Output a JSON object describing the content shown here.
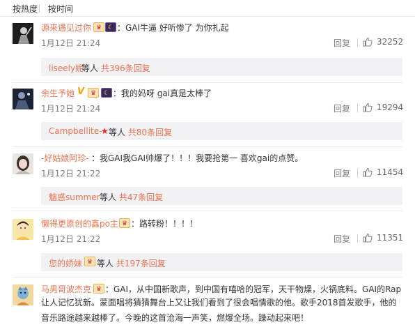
{
  "sort_tabs": [
    "按热度",
    "按时间"
  ],
  "comments": [
    {
      "user": "源来遇见过你",
      "badges": [
        "vip-icon",
        "night-icon"
      ],
      "text": "：GAI牛逼  好听惨了 为你扎起",
      "time": "1月12日 21:24",
      "reply_label": "回复",
      "likes": "32252",
      "sub_user": "liseely妮",
      "sub_middle": " 等人 ",
      "sub_count": "共396条回复"
    },
    {
      "user": "余生予她",
      "badges": [
        "verified-v-icon",
        "vip-icon",
        "night-icon"
      ],
      "text": "：我的妈呀 gai真是太棒了",
      "time": "1月12日 21:24",
      "reply_label": "回复",
      "likes": "19294",
      "sub_user": "Campbellite-",
      "sub_middle": " 等人 ",
      "sub_count": "共80条回复"
    },
    {
      "user": "-好姑娘阿珍-",
      "badges": [],
      "text": "：我GAI我GAI帅爆了！！！我要抢第一 喜欢gai的点赞。",
      "time": "1月12日 21:22",
      "reply_label": "回复",
      "likes": "11454",
      "sub_user": "魑惑summer",
      "sub_middle": " 等人 ",
      "sub_count": "共47条回复"
    },
    {
      "user": "懒得更原创的鑫po主",
      "badges": [
        "vip-icon"
      ],
      "text": "：路转粉！！！！",
      "time": "1月12日 21:22",
      "reply_label": "回复",
      "likes": "11351",
      "sub_user": "您的娇妹",
      "sub_middle": " 等人 ",
      "sub_count": "共197条回复"
    },
    {
      "user": "马男哥波杰克",
      "badges": [
        "vip-icon"
      ],
      "text_lines": [
        "：GAI，从中国新歌声，到中国有嘻哈的冠军，天干物燥，火锅底料。GAI的Rap",
        "让人记忆犹新。蒙面唱将猜猜舞台上又让我们看到了很会唱情歌的他。歌手2018首发歌手，他的",
        "音乐路途越来越棒了。今晚的这首沧海一声笑，燃爆全场。躁动起来吧！"
      ]
    }
  ]
}
